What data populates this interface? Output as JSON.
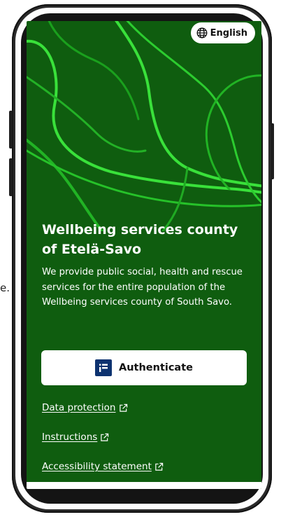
{
  "stray_text": "e.",
  "language": {
    "label": "English",
    "icon": "globe-icon"
  },
  "hero": {
    "title": "Wellbeing services county of Etelä-Savo",
    "description": "We provide public social, health and rescue services for the entire population of the Wellbeing services county of South Savo."
  },
  "auth": {
    "label": "Authenticate",
    "icon": "identification-icon"
  },
  "links": [
    {
      "label": "Data protection",
      "icon": "external-link-icon"
    },
    {
      "label": "Instructions",
      "icon": "external-link-icon"
    },
    {
      "label": "Accessibility statement",
      "icon": "external-link-icon"
    }
  ],
  "colors": {
    "background": "#0f5d0f",
    "line_bright": "#39e13a",
    "line_mid": "#21b324",
    "auth_icon": "#0d3270"
  }
}
